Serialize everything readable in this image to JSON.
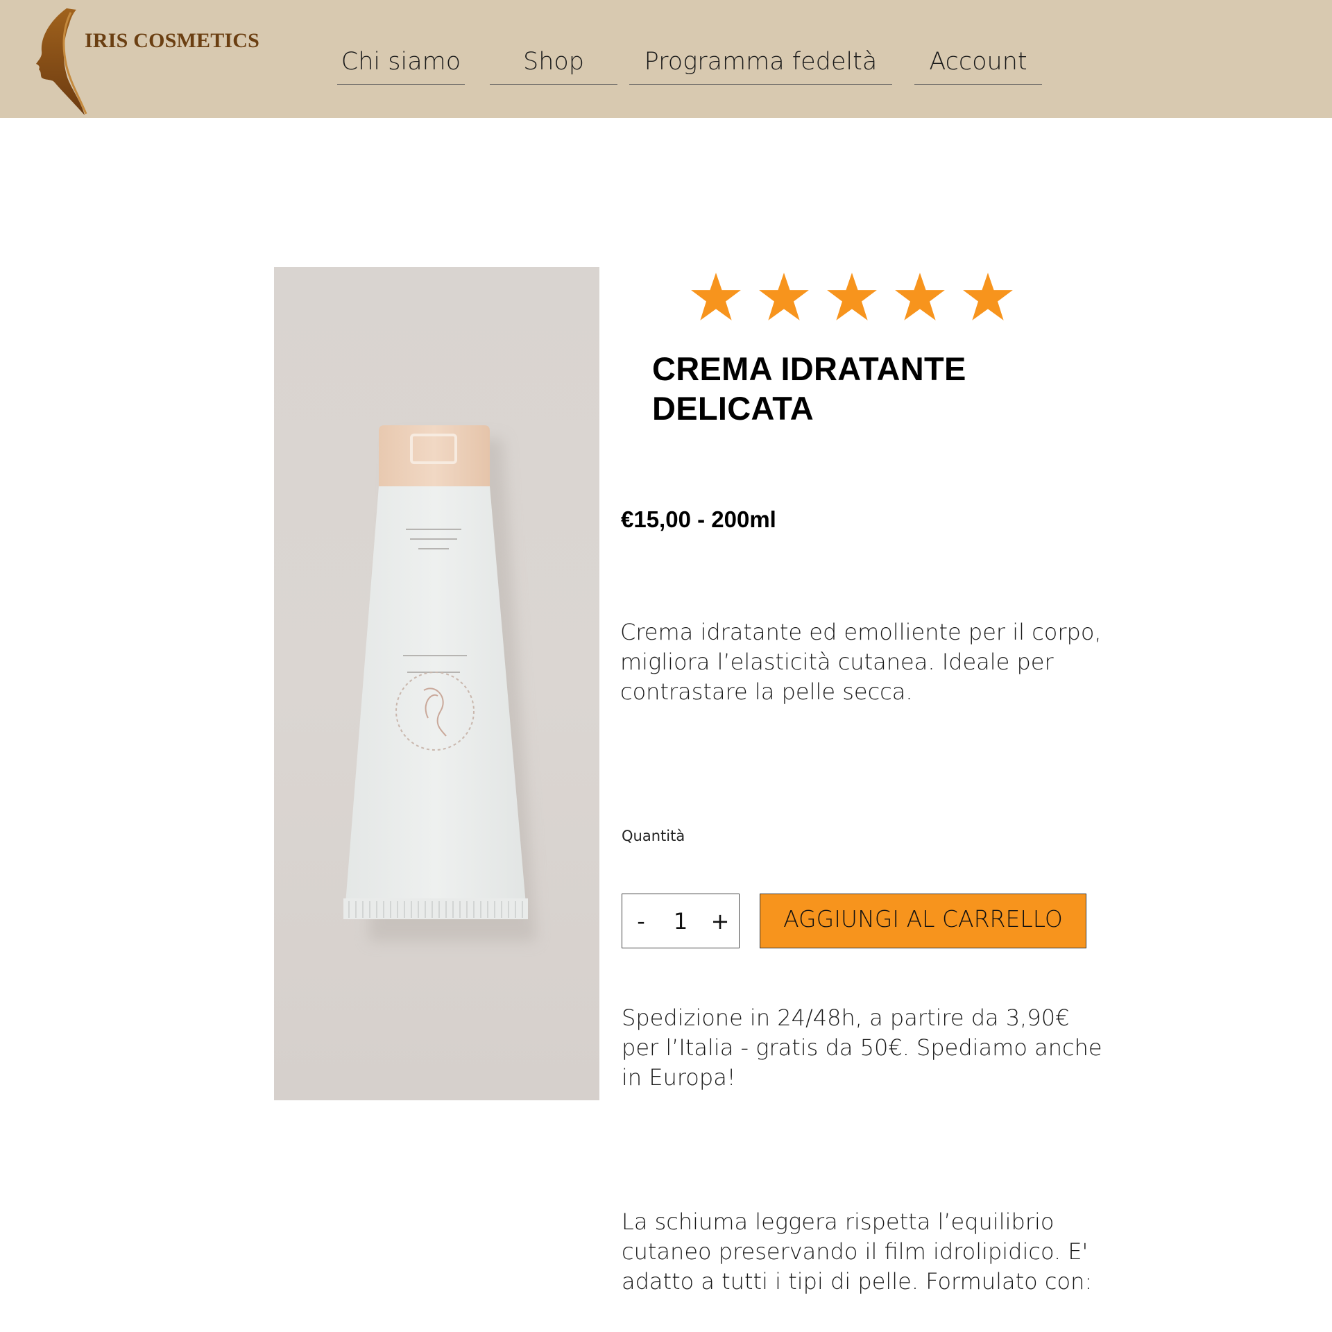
{
  "brand": {
    "name": "IRIS COSMETICS",
    "logo_icon": "woman-profile-logo"
  },
  "nav": [
    {
      "label": "Chi siamo"
    },
    {
      "label": "Shop"
    },
    {
      "label": "Programma fedeltà"
    },
    {
      "label": "Account"
    }
  ],
  "product": {
    "image_icon": "cosmetic-tube-image",
    "rating": {
      "value": 5,
      "max": 5,
      "color": "#f7941d"
    },
    "title_line1": "CREMA IDRATANTE",
    "title_line2": "DELICATA",
    "price": "€15,00 - 200ml",
    "description": "Crema idratante ed emolliente per il corpo, migliora l’elasticità cutanea. Ideale per contrastare la pelle secca.",
    "quantity": {
      "label": "Quantità",
      "minus": "-",
      "value": "1",
      "plus": "+"
    },
    "add_to_cart": "AGGIUNGI AL CARRELLO",
    "shipping": "Spedizione in 24/48h, a partire da 3,90€ per l’Italia - gratis da 50€. Spediamo anche in Europa!",
    "details": "La schiuma leggera rispetta l’equilibrio cutaneo preservando il film idrolipidico. E' adatto a tutti i tipi di pelle. Formulato con:"
  },
  "colors": {
    "header_bg": "#d8c9b0",
    "brand_text": "#6b3f12",
    "accent": "#f7941d"
  }
}
